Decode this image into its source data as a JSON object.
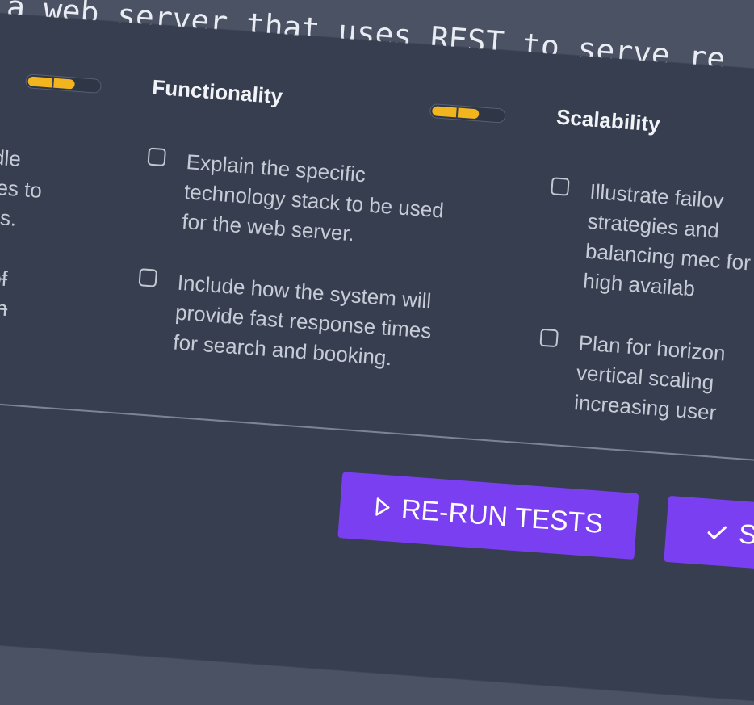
{
  "background_line": "a web server that uses REST to serve re",
  "left_column": {
    "fragments": [
      "ndle",
      "ates to",
      "ngs."
    ],
    "strike_fragments": [
      "n of",
      "with"
    ]
  },
  "columns": [
    {
      "heading": "Functionality",
      "progress_fraction": 0.66,
      "items": [
        {
          "text": "Explain the specific technology stack to be used for the web server.",
          "checked": false
        },
        {
          "text": "Include how the system will provide fast response times for search and booking.",
          "checked": false
        }
      ]
    },
    {
      "heading": "Scalability",
      "progress_fraction": 0.66,
      "items": [
        {
          "text": "Illustrate failov strategies and balancing mec for high availab",
          "checked": false
        },
        {
          "text": "Plan for horizon vertical scaling increasing user",
          "checked": false
        }
      ]
    }
  ],
  "left_progress_fraction": 0.66,
  "buttons": {
    "rerun_icon": "play-outline-icon",
    "rerun_label": "RE-RUN TESTS",
    "submit_icon": "checkmark-icon",
    "submit_label": "S"
  },
  "colors": {
    "accent": "#7b3ff2",
    "progress": "#f2b51e",
    "panel": "#363e50",
    "page": "#4a5264"
  }
}
